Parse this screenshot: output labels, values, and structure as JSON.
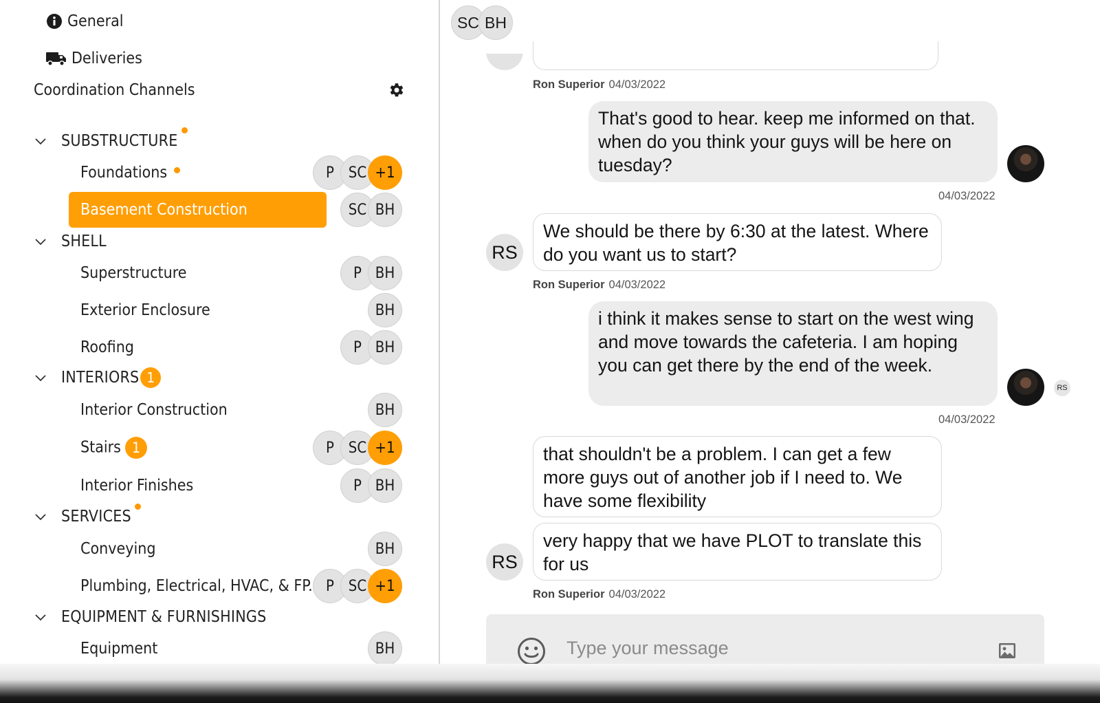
{
  "sidebar": {
    "general_label": "General",
    "deliveries_label": "Deliveries",
    "coordination_title": "Coordination Channels",
    "sections": [
      {
        "label": "SUBSTRUCTURE"
      },
      {
        "label": "SHELL"
      },
      {
        "label": "INTERIORS",
        "badge": "1"
      },
      {
        "label": "SERVICES"
      },
      {
        "label": "EQUIPMENT & FURNISHINGS"
      }
    ],
    "channels": {
      "foundations": {
        "label": "Foundations",
        "members": [
          "P",
          "SC",
          "+1"
        ]
      },
      "basement": {
        "label": "Basement Construction",
        "members": [
          "SC",
          "BH"
        ]
      },
      "superstructure": {
        "label": "Superstructure",
        "members": [
          "P",
          "BH"
        ]
      },
      "exterior": {
        "label": "Exterior Enclosure",
        "members": [
          "BH"
        ]
      },
      "roofing": {
        "label": "Roofing",
        "members": [
          "P",
          "BH"
        ]
      },
      "interior_construction": {
        "label": "Interior Construction",
        "members": [
          "BH"
        ]
      },
      "stairs": {
        "label": "Stairs",
        "badge": "1",
        "members": [
          "P",
          "SC",
          "+1"
        ]
      },
      "interior_finishes": {
        "label": "Interior Finishes",
        "members": [
          "P",
          "BH"
        ]
      },
      "conveying": {
        "label": "Conveying",
        "members": [
          "BH"
        ]
      },
      "plumbing": {
        "label": "Plumbing, Electrical, HVAC, & FP.",
        "members": [
          "P",
          "SC",
          "+1"
        ]
      },
      "equipment": {
        "label": "Equipment",
        "members": [
          "BH"
        ]
      }
    }
  },
  "chat": {
    "members": [
      "SC",
      "BH"
    ],
    "messages": [
      {
        "meta_name": "Ron Superior",
        "meta_date": "04/03/2022"
      },
      {
        "direction": "out",
        "text": "That's good to hear. keep me informed on that. when do you think your guys will be here on tuesday?",
        "date": "04/03/2022"
      },
      {
        "direction": "in",
        "initials": "RS",
        "text": "We should be there by 6:30 at the latest. Where do you want us to start?",
        "meta_name": "Ron Superior",
        "meta_date": "04/03/2022"
      },
      {
        "direction": "out",
        "text": "i think it makes sense to start on the west wing and move towards the cafeteria. I am hoping you can get there by the end of the week.",
        "date": "04/03/2022",
        "read_by": "RS"
      },
      {
        "direction": "in",
        "text": "that shouldn't be a problem. I can get a few more guys out of another job if I need to. We have some flexibility"
      },
      {
        "direction": "in",
        "initials": "RS",
        "text": "very happy that we have PLOT to translate this for us",
        "meta_name": "Ron Superior",
        "meta_date": "04/03/2022"
      }
    ],
    "composer": {
      "placeholder": "Type your message"
    }
  },
  "colors": {
    "accent": "#ff9e05",
    "bubble_out": "#ececec",
    "avatar_gray": "#e3e3e3"
  },
  "icons": [
    "info-icon",
    "truck-icon",
    "gear-icon",
    "chevron-down-icon",
    "emoji-icon",
    "image-icon"
  ]
}
